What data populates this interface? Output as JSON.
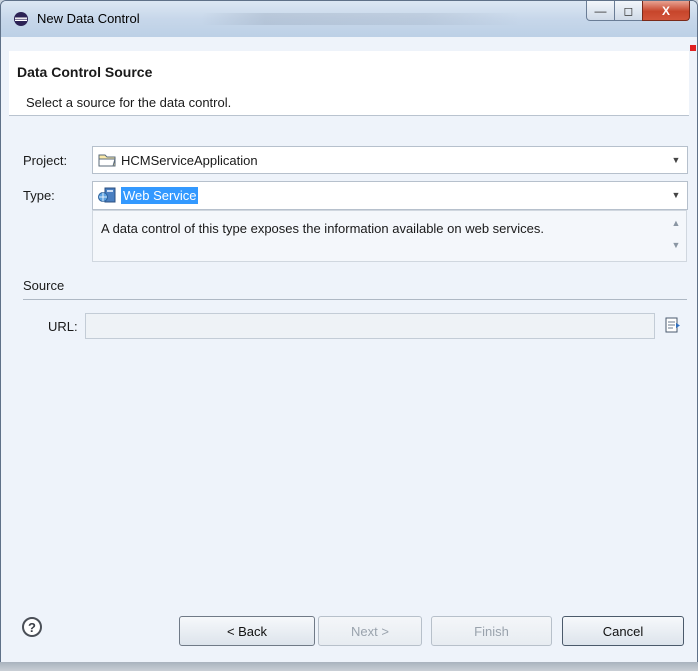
{
  "window": {
    "title": "New Data Control"
  },
  "header": {
    "title": "Data Control Source",
    "subtitle": "Select a source for the data control."
  },
  "form": {
    "project_label": "Project:",
    "project_value": "HCMServiceApplication",
    "type_label": "Type:",
    "type_value": "Web Service",
    "description": "A data control of this type exposes the information available on web services.",
    "source_section_label": "Source",
    "url_label": "URL:",
    "url_value": ""
  },
  "footer": {
    "back_label": "< Back",
    "next_label": "Next >",
    "finish_label": "Finish",
    "cancel_label": "Cancel"
  },
  "icons": {
    "window": "eclipse-icon",
    "project": "folder-icon",
    "type": "web-service-icon",
    "browse": "browse-icon",
    "help": "help-icon"
  },
  "colors": {
    "selection": "#3399ff",
    "close_button": "#c7452b"
  }
}
